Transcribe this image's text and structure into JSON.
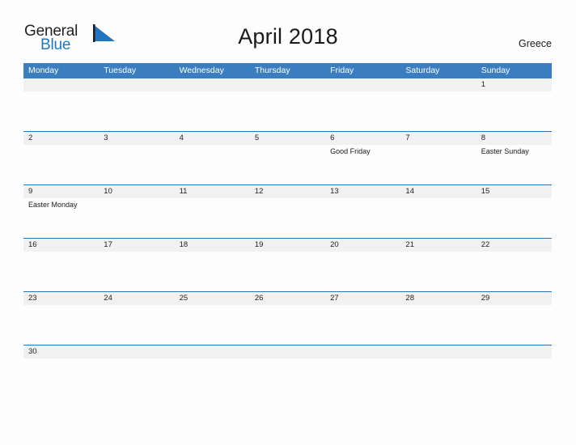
{
  "brand": {
    "word_one": "General",
    "word_two": "Blue",
    "mark": "triangle-logo-icon",
    "accent_color": "#2176bd"
  },
  "header": {
    "title": "April 2018",
    "location": "Greece"
  },
  "theme": {
    "header_blue": "#3a7ebf",
    "rule_blue": "#2e74b5",
    "number_band_gray": "#f1f1f1",
    "page_background": "#fdfdfd"
  },
  "calendar": {
    "day_names": [
      "Monday",
      "Tuesday",
      "Wednesday",
      "Thursday",
      "Friday",
      "Saturday",
      "Sunday"
    ],
    "weeks": [
      [
        {
          "num": "",
          "events": []
        },
        {
          "num": "",
          "events": []
        },
        {
          "num": "",
          "events": []
        },
        {
          "num": "",
          "events": []
        },
        {
          "num": "",
          "events": []
        },
        {
          "num": "",
          "events": []
        },
        {
          "num": "1",
          "events": []
        }
      ],
      [
        {
          "num": "2",
          "events": []
        },
        {
          "num": "3",
          "events": []
        },
        {
          "num": "4",
          "events": []
        },
        {
          "num": "5",
          "events": []
        },
        {
          "num": "6",
          "events": [
            "Good Friday"
          ]
        },
        {
          "num": "7",
          "events": []
        },
        {
          "num": "8",
          "events": [
            "Easter Sunday"
          ]
        }
      ],
      [
        {
          "num": "9",
          "events": [
            "Easter Monday"
          ]
        },
        {
          "num": "10",
          "events": []
        },
        {
          "num": "11",
          "events": []
        },
        {
          "num": "12",
          "events": []
        },
        {
          "num": "13",
          "events": []
        },
        {
          "num": "14",
          "events": []
        },
        {
          "num": "15",
          "events": []
        }
      ],
      [
        {
          "num": "16",
          "events": []
        },
        {
          "num": "17",
          "events": []
        },
        {
          "num": "18",
          "events": []
        },
        {
          "num": "19",
          "events": []
        },
        {
          "num": "20",
          "events": []
        },
        {
          "num": "21",
          "events": []
        },
        {
          "num": "22",
          "events": []
        }
      ],
      [
        {
          "num": "23",
          "events": []
        },
        {
          "num": "24",
          "events": []
        },
        {
          "num": "25",
          "events": []
        },
        {
          "num": "26",
          "events": []
        },
        {
          "num": "27",
          "events": []
        },
        {
          "num": "28",
          "events": []
        },
        {
          "num": "29",
          "events": []
        }
      ],
      [
        {
          "num": "30",
          "events": []
        },
        {
          "num": "",
          "events": []
        },
        {
          "num": "",
          "events": []
        },
        {
          "num": "",
          "events": []
        },
        {
          "num": "",
          "events": []
        },
        {
          "num": "",
          "events": []
        },
        {
          "num": "",
          "events": []
        }
      ]
    ]
  }
}
